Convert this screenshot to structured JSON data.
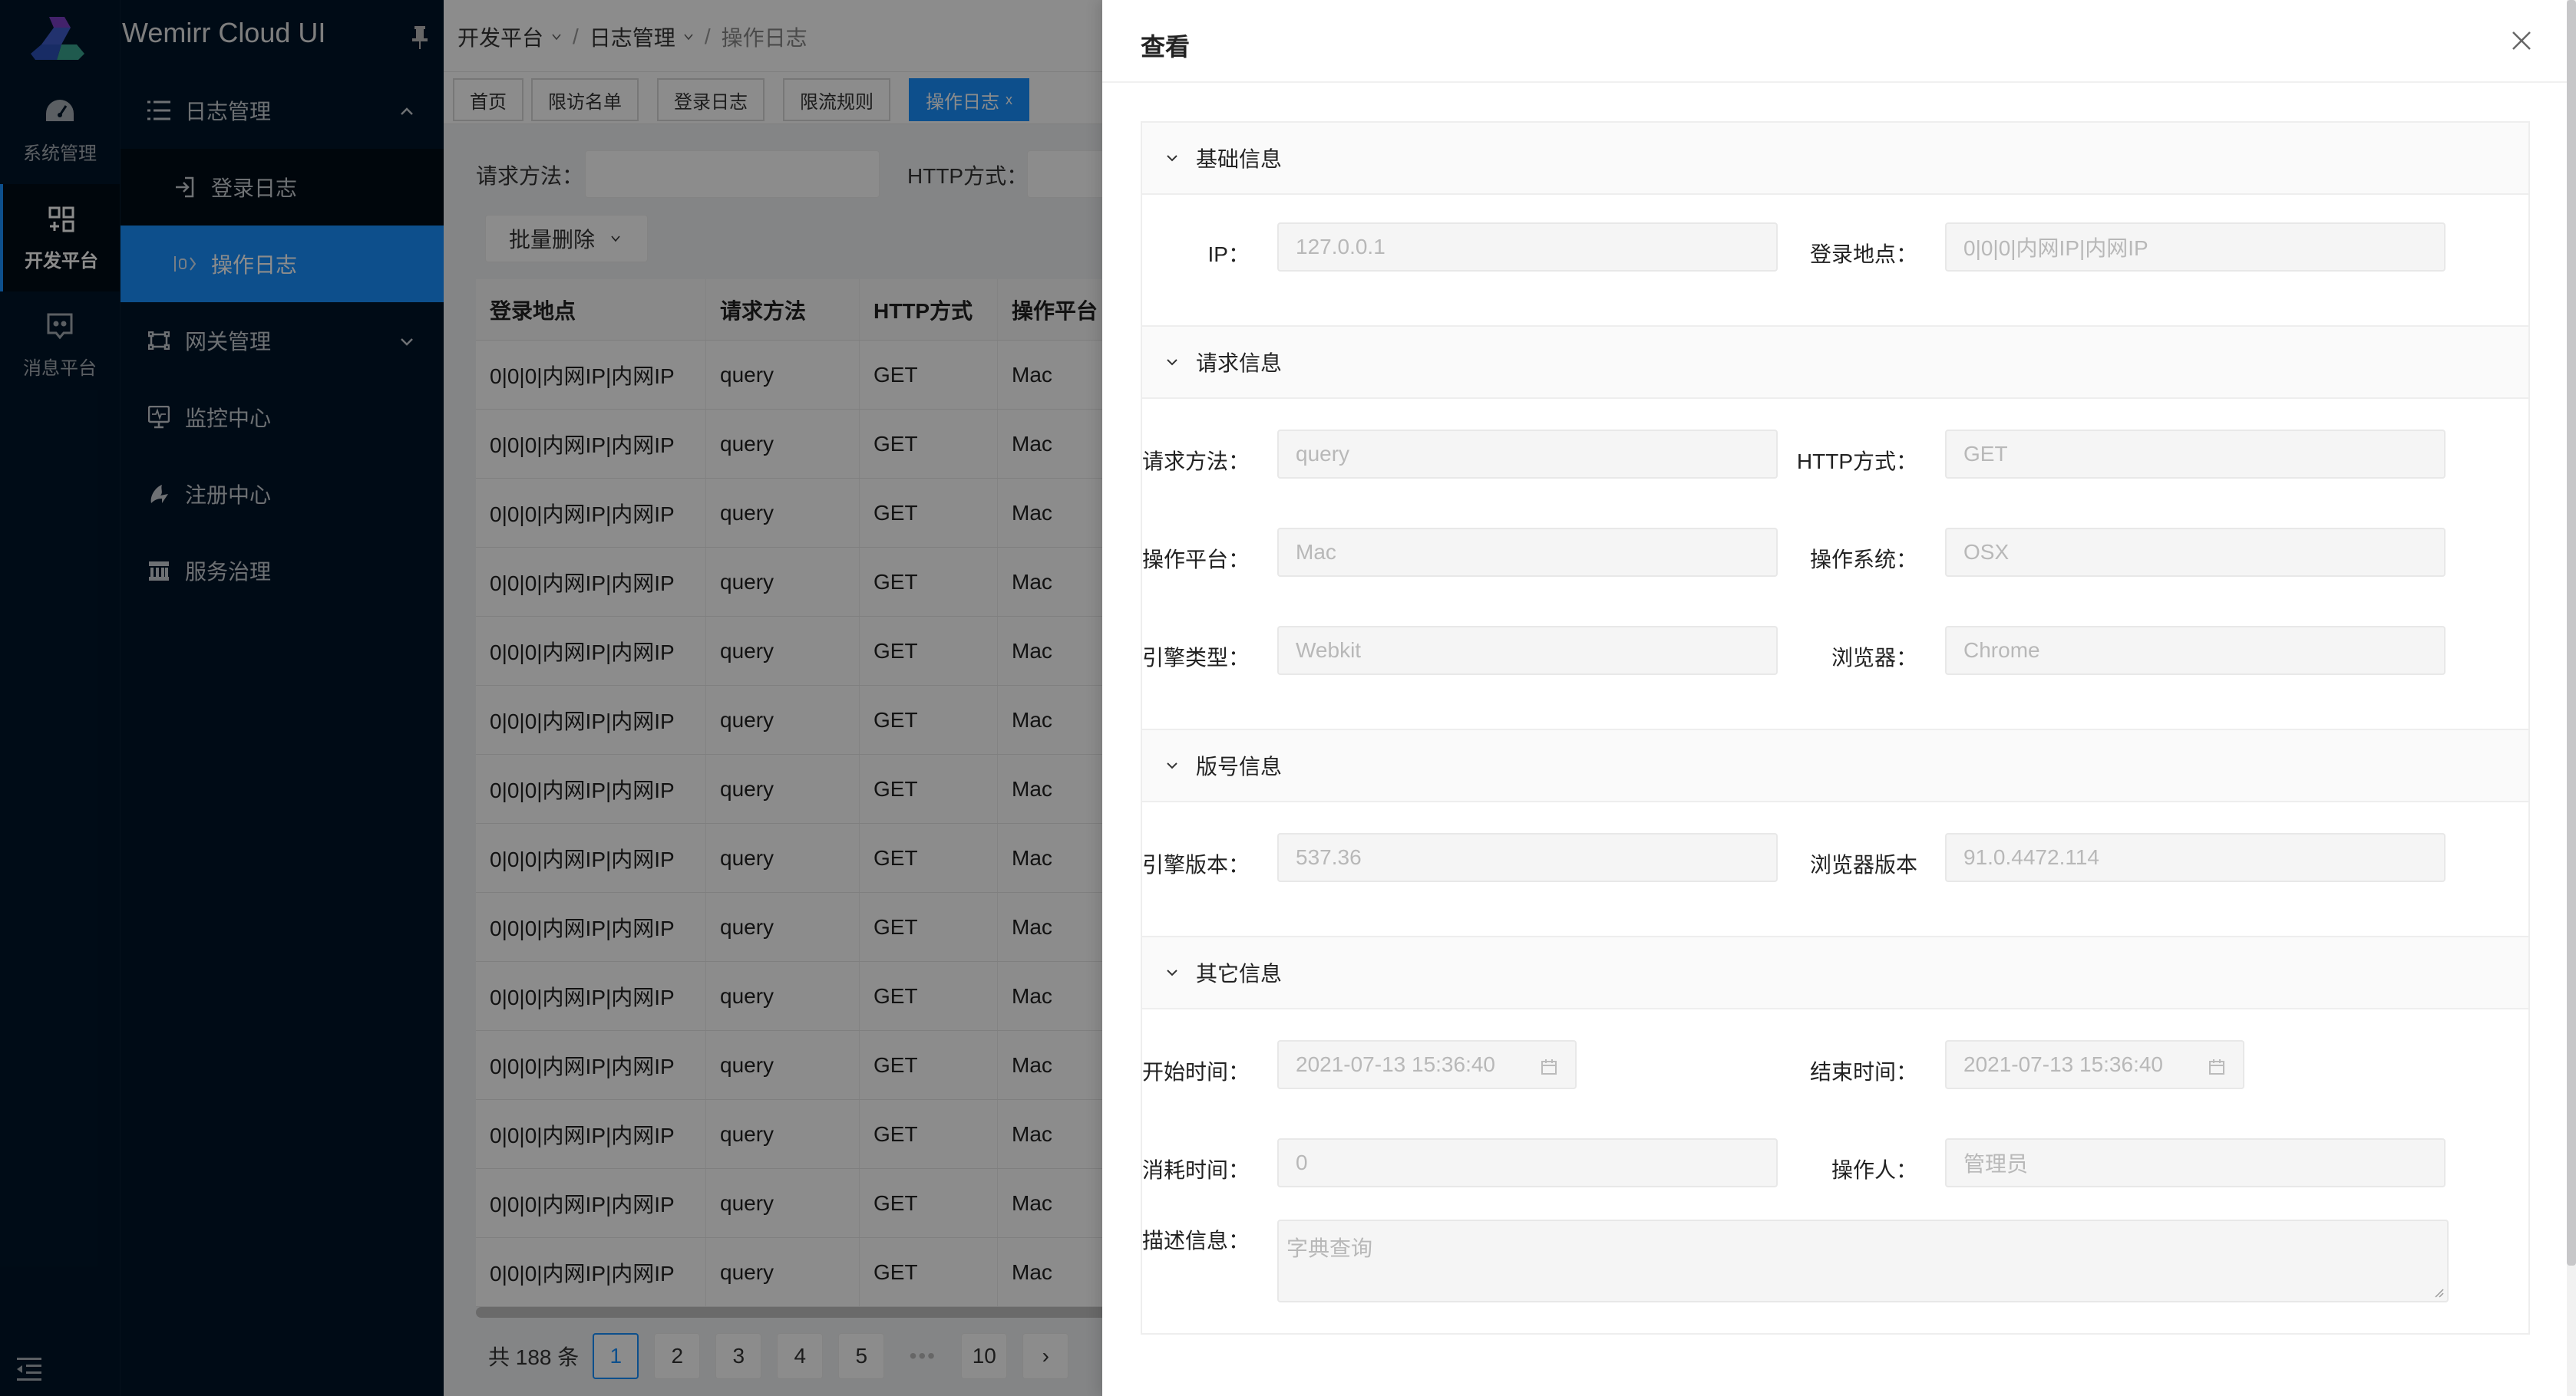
{
  "app": {
    "title": "Wemirr Cloud UI"
  },
  "rail": {
    "items": [
      {
        "label": "系统管理",
        "icon": "dashboard-icon"
      },
      {
        "label": "开发平台",
        "icon": "appstore-add-icon",
        "active": true
      },
      {
        "label": "消息平台",
        "icon": "message-icon"
      }
    ]
  },
  "menu": {
    "groups": [
      {
        "label": "日志管理",
        "icon": "list-icon",
        "expanded": true,
        "children": [
          {
            "label": "登录日志",
            "icon": "login-icon"
          },
          {
            "label": "操作日志",
            "icon": "code-icon",
            "selected": true
          }
        ]
      },
      {
        "label": "网关管理",
        "icon": "gateway-icon",
        "expanded": false
      },
      {
        "label": "监控中心",
        "icon": "monitor-icon"
      },
      {
        "label": "注册中心",
        "icon": "register-icon"
      },
      {
        "label": "服务治理",
        "icon": "bank-icon"
      }
    ]
  },
  "breadcrumb": [
    "开发平台",
    "日志管理",
    "操作日志"
  ],
  "tabs": [
    {
      "label": "首页"
    },
    {
      "label": "限访名单"
    },
    {
      "label": "登录日志"
    },
    {
      "label": "限流规则"
    },
    {
      "label": "操作日志",
      "active": true,
      "close": "x"
    }
  ],
  "search": {
    "fields": [
      {
        "label": "请求方法：",
        "value": ""
      },
      {
        "label": "HTTP方式：",
        "value": ""
      }
    ],
    "batch_delete": "批量删除"
  },
  "table": {
    "columns": [
      "登录地点",
      "请求方法",
      "HTTP方式",
      "操作平台"
    ],
    "rows": [
      [
        "0|0|0|内网IP|内网IP",
        "query",
        "GET",
        "Mac"
      ],
      [
        "0|0|0|内网IP|内网IP",
        "query",
        "GET",
        "Mac"
      ],
      [
        "0|0|0|内网IP|内网IP",
        "query",
        "GET",
        "Mac"
      ],
      [
        "0|0|0|内网IP|内网IP",
        "query",
        "GET",
        "Mac"
      ],
      [
        "0|0|0|内网IP|内网IP",
        "query",
        "GET",
        "Mac"
      ],
      [
        "0|0|0|内网IP|内网IP",
        "query",
        "GET",
        "Mac"
      ],
      [
        "0|0|0|内网IP|内网IP",
        "query",
        "GET",
        "Mac"
      ],
      [
        "0|0|0|内网IP|内网IP",
        "query",
        "GET",
        "Mac"
      ],
      [
        "0|0|0|内网IP|内网IP",
        "query",
        "GET",
        "Mac"
      ],
      [
        "0|0|0|内网IP|内网IP",
        "query",
        "GET",
        "Mac"
      ],
      [
        "0|0|0|内网IP|内网IP",
        "query",
        "GET",
        "Mac"
      ],
      [
        "0|0|0|内网IP|内网IP",
        "query",
        "GET",
        "Mac"
      ],
      [
        "0|0|0|内网IP|内网IP",
        "query",
        "GET",
        "Mac"
      ],
      [
        "0|0|0|内网IP|内网IP",
        "query",
        "GET",
        "Mac"
      ]
    ]
  },
  "pagination": {
    "total_text": "共 188 条",
    "pages": [
      "1",
      "2",
      "3",
      "4",
      "5"
    ],
    "ellipsis": "•••",
    "last": "10",
    "current": "1",
    "next": "›"
  },
  "drawer": {
    "title": "查看",
    "sections": [
      {
        "title": "基础信息",
        "rows": [
          [
            {
              "label": "IP：",
              "value": "127.0.0.1"
            },
            {
              "label": "登录地点：",
              "value": "0|0|0|内网IP|内网IP"
            }
          ]
        ]
      },
      {
        "title": "请求信息",
        "rows": [
          [
            {
              "label": "请求方法：",
              "value": "query"
            },
            {
              "label": "HTTP方式：",
              "value": "GET"
            }
          ],
          [
            {
              "label": "操作平台：",
              "value": "Mac"
            },
            {
              "label": "操作系统：",
              "value": "OSX"
            }
          ],
          [
            {
              "label": "引擎类型：",
              "value": "Webkit"
            },
            {
              "label": "浏览器：",
              "value": "Chrome"
            }
          ]
        ]
      },
      {
        "title": "版号信息",
        "rows": [
          [
            {
              "label": "引擎版本：",
              "value": "537.36"
            },
            {
              "label": "浏览器版本",
              "value": "91.0.4472.114"
            }
          ]
        ]
      },
      {
        "title": "其它信息",
        "rows": [
          [
            {
              "label": "开始时间：",
              "value": "2021-07-13 15:36:40",
              "type": "date"
            },
            {
              "label": "结束时间：",
              "value": "2021-07-13 15:36:40",
              "type": "date"
            }
          ],
          [
            {
              "label": "消耗时间：",
              "value": "0"
            },
            {
              "label": "操作人：",
              "value": "管理员"
            }
          ]
        ],
        "textarea": {
          "label": "描述信息：",
          "value": "字典查询"
        }
      }
    ]
  },
  "colors": {
    "sidebar_bg": "#001529",
    "primary": "#1890ff",
    "mask": "rgba(0,0,0,0.45)"
  }
}
